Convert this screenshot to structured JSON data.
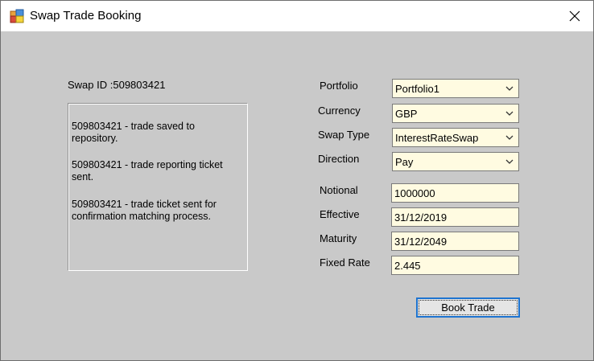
{
  "window": {
    "title": "Swap Trade Booking",
    "app_icon": "windows-form-icon",
    "close_icon": "close-icon"
  },
  "swap": {
    "id_label": "Swap ID :509803421"
  },
  "log": {
    "messages": [
      "509803421 - trade saved to repository.",
      "509803421 - trade reporting ticket sent.",
      "509803421 - trade ticket sent for confirmation matching process."
    ]
  },
  "form": {
    "portfolio_label": "Portfolio",
    "portfolio_value": "Portfolio1",
    "currency_label": "Currency",
    "currency_value": "GBP",
    "swap_type_label": "Swap Type",
    "swap_type_value": "InterestRateSwap",
    "direction_label": "Direction",
    "direction_value": "Pay",
    "notional_label": "Notional",
    "notional_value": "1000000",
    "effective_label": "Effective",
    "effective_value": "31/12/2019",
    "maturity_label": "Maturity",
    "maturity_value": "31/12/2049",
    "fixed_rate_label": "Fixed Rate",
    "fixed_rate_value": "2.445"
  },
  "actions": {
    "book_trade_label": "Book Trade"
  },
  "colors": {
    "form_background": "#c9c9c9",
    "input_background": "#fffbe1",
    "button_focus_border": "#1e74d0"
  }
}
